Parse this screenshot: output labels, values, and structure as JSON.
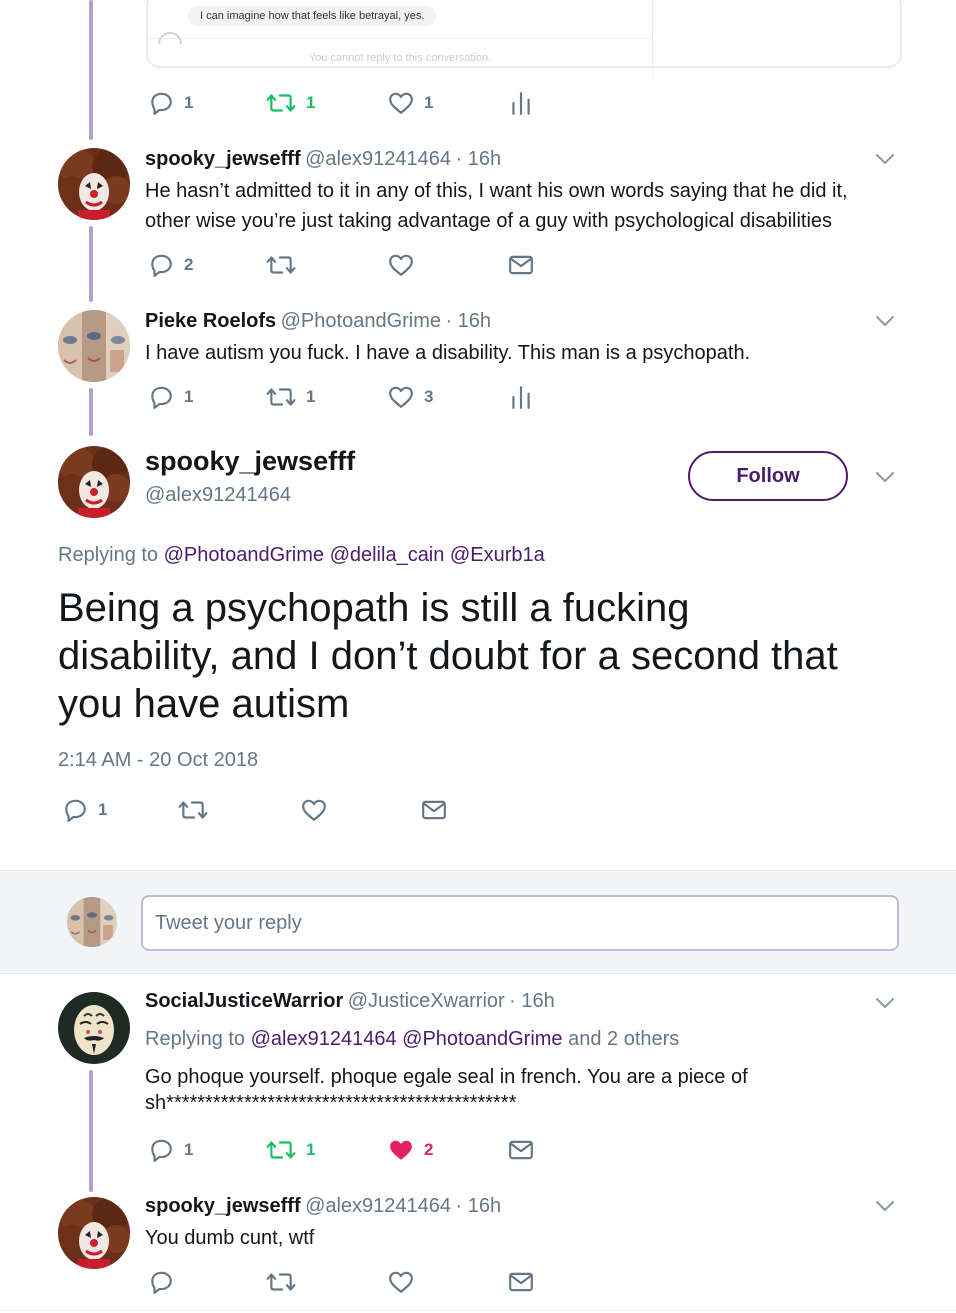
{
  "quoted_card": {
    "message": "I can imagine how that feels like betrayal, yes.",
    "footer": "You cannot reply to this conversation."
  },
  "top_actions": {
    "replies": "1",
    "retweets": "1",
    "likes": "1"
  },
  "tweets": [
    {
      "name": "spooky_jewsefff",
      "handle": "@alex91241464",
      "time": "· 16h",
      "text_line1": "He hasn’t admitted to it in any of this, I want his own words saying that he did it,",
      "text_line2": "other wise you’re just taking advantage of a guy with psychological disabilities",
      "replies": "2",
      "retweets": "",
      "likes": ""
    },
    {
      "name": "Pieke Roelofs",
      "handle": "@PhotoandGrime",
      "time": "· 16h",
      "text_line1": "I have autism you fuck. I have a disability. This man is a psychopath.",
      "replies": "1",
      "retweets": "1",
      "likes": "3"
    }
  ],
  "main_tweet": {
    "name": "spooky_jewsefff",
    "handle": "@alex91241464",
    "follow_label": "Follow",
    "replying_prefix": "Replying to",
    "replying_to": "@PhotoandGrime @delila_cain @Exurb1a",
    "text_line1": "Being a psychopath is still a fucking",
    "text_line2": "disability, and I don’t doubt for a second that",
    "text_line3": "you have autism",
    "timestamp": "2:14 AM - 20 Oct 2018",
    "replies": "1"
  },
  "reply_box": {
    "placeholder": "Tweet your reply"
  },
  "replies": [
    {
      "name": "SocialJusticeWarrior",
      "handle": "@JusticeXwarrior",
      "time": "· 16h",
      "replying_prefix": "Replying to",
      "replying_to": "@alex91241464 @PhotoandGrime",
      "replying_suffix": "and 2 others",
      "text_line1": "Go phoque yourself. phoque egale seal in french. You are a piece of",
      "text_line2": "sh*********************************************",
      "replies": "1",
      "retweets": "1",
      "likes": "2"
    },
    {
      "name": "spooky_jewsefff",
      "handle": "@alex91241464",
      "time": "· 16h",
      "text_line1": "You dumb cunt, wtf"
    }
  ],
  "colors": {
    "accent": "#4b1c6b",
    "retweet": "#17bf63",
    "like": "#e0245e",
    "thread": "#b5a0c8"
  }
}
